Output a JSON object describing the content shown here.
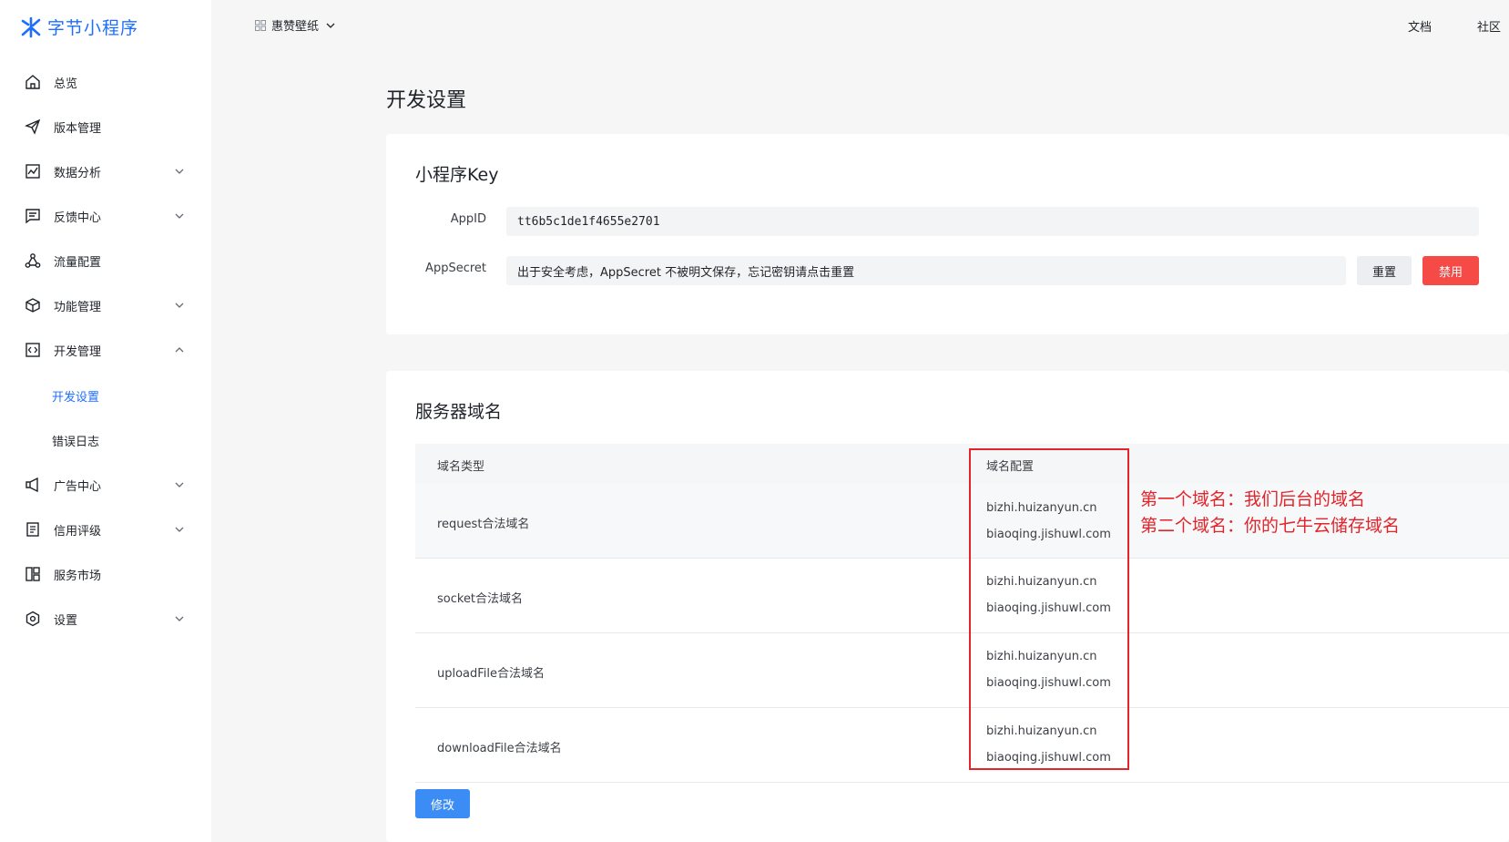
{
  "brand": {
    "name": "字节小程序",
    "color": "#1e6fff"
  },
  "sidebar": {
    "items": [
      {
        "label": "总览",
        "icon": "home-icon",
        "chevron": ""
      },
      {
        "label": "版本管理",
        "icon": "send-icon",
        "chevron": ""
      },
      {
        "label": "数据分析",
        "icon": "chart-icon",
        "chevron": "down"
      },
      {
        "label": "反馈中心",
        "icon": "message-icon",
        "chevron": "down"
      },
      {
        "label": "流量配置",
        "icon": "network-icon",
        "chevron": ""
      },
      {
        "label": "功能管理",
        "icon": "cube-icon",
        "chevron": "down"
      },
      {
        "label": "开发管理",
        "icon": "code-icon",
        "chevron": "up"
      },
      {
        "label": "广告中心",
        "icon": "megaphone-icon",
        "chevron": "down"
      },
      {
        "label": "信用评级",
        "icon": "document-icon",
        "chevron": "down"
      },
      {
        "label": "服务市场",
        "icon": "layout-icon",
        "chevron": ""
      },
      {
        "label": "设置",
        "icon": "settings-icon",
        "chevron": "down"
      }
    ],
    "sub_items": [
      {
        "label": "开发设置",
        "active": true
      },
      {
        "label": "错误日志",
        "active": false
      }
    ]
  },
  "topbar": {
    "app_name": "惠赞壁纸",
    "links": [
      "文档",
      "社区"
    ]
  },
  "page": {
    "title": "开发设置"
  },
  "key_card": {
    "title": "小程序Key",
    "appid_label": "AppID",
    "appid_value": "tt6b5c1de1f4655e2701",
    "secret_label": "AppSecret",
    "secret_value": "出于安全考虑，AppSecret 不被明文保存，忘记密钥请点击重置",
    "reset_button": "重置",
    "disable_button": "禁用"
  },
  "server_card": {
    "title": "服务器域名",
    "columns": [
      "域名类型",
      "域名配置"
    ],
    "rows": [
      {
        "type": "request合法域名",
        "domains": [
          "bizhi.huizanyun.cn",
          "biaoqing.jishuwl.com"
        ]
      },
      {
        "type": "socket合法域名",
        "domains": [
          "bizhi.huizanyun.cn",
          "biaoqing.jishuwl.com"
        ]
      },
      {
        "type": "uploadFile合法域名",
        "domains": [
          "bizhi.huizanyun.cn",
          "biaoqing.jishuwl.com"
        ]
      },
      {
        "type": "downloadFile合法域名",
        "domains": [
          "bizhi.huizanyun.cn",
          "biaoqing.jishuwl.com"
        ]
      }
    ],
    "modify_button": "修改"
  },
  "annotations": {
    "color": "#e3242b",
    "lines": [
      "第一个域名：我们后台的域名",
      "第二个域名：你的七牛云储存域名"
    ]
  },
  "colors": {
    "primary": "#1e6fff",
    "danger": "#f54a45",
    "button_blue": "#3c8cf6"
  }
}
